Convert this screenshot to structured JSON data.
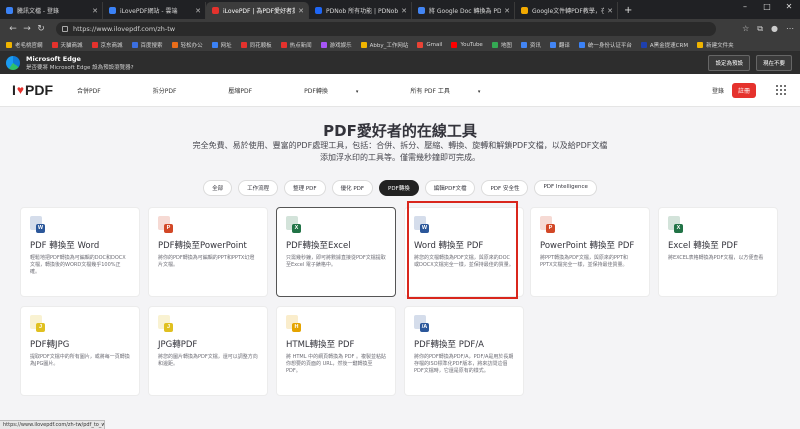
{
  "tabs": [
    {
      "title": "騰訊文檔 - 登錄",
      "color": "#3b82f6"
    },
    {
      "title": "iLovePDF網站 - 雲端",
      "color": "#3b82f6"
    },
    {
      "title": "iLovePDF | 為PDF愛好者提供的PDF",
      "color": "#e5322d",
      "active": true
    },
    {
      "title": "PDNob 所有功能 | PDNob PDF 編",
      "color": "#1e66f5"
    },
    {
      "title": "將 Google Doc 轉換為 PDF 的三個",
      "color": "#4285f4"
    },
    {
      "title": "Google文件轉PDF教學，在iOS/An",
      "color": "#f2a900"
    }
  ],
  "address": "https://www.ilovepdf.com/zh-tw",
  "bookmarks": [
    {
      "label": "老毛桃官網",
      "color": "#f0b400"
    },
    {
      "label": "天貓商城",
      "color": "#e5322d"
    },
    {
      "label": "京东商城",
      "color": "#e5322d"
    },
    {
      "label": "百度搜索",
      "color": "#3b6fe0"
    },
    {
      "label": "轻松办公",
      "color": "#e96d1a"
    },
    {
      "label": "网址",
      "color": "#3b82f6"
    },
    {
      "label": "同花顺板",
      "color": "#e5322d"
    },
    {
      "label": "热点新闻",
      "color": "#e5322d"
    },
    {
      "label": "游戏娱乐",
      "color": "#a855f7"
    },
    {
      "label": "Abby_工作网站",
      "color": "#f0b400"
    },
    {
      "label": "Gmail",
      "color": "#ea4335"
    },
    {
      "label": "YouTube",
      "color": "#ff0000"
    },
    {
      "label": "地图",
      "color": "#34a853"
    },
    {
      "label": "资讯",
      "color": "#4285f4"
    },
    {
      "label": "翻译",
      "color": "#4285f4"
    },
    {
      "label": "统一身份认证平台",
      "color": "#3b82f6"
    },
    {
      "label": "A黑金提速CRM",
      "color": "#1e40af"
    },
    {
      "label": "新建文件夹",
      "color": "#f0b400"
    }
  ],
  "edge": {
    "title": "Microsoft Edge",
    "subtitle": "是否要將 Microsoft Edge 設為預設瀏覽器?",
    "btn_default": "設定為預設",
    "btn_later": "現在不要"
  },
  "site": {
    "brand_left": "I",
    "brand_right": "PDF",
    "nav": [
      "合併PDF",
      "拆分PDF",
      "壓縮PDF",
      "PDF轉換",
      "所有 PDF 工具"
    ],
    "login": "登錄",
    "signup": "註冊",
    "hero_title": "PDF愛好者的在線工具",
    "hero_sub": "完全免費、易於使用、豐富的PDF處理工具，包括：合併、拆分、壓縮、轉換、旋轉和解鎖PDF文檔，以及給PDF文檔添加浮水印的工具等。僅需幾秒鐘即可完成。",
    "filters": [
      "全部",
      "工作流程",
      "整理 PDF",
      "優化 PDF",
      "PDF轉換",
      "編輯PDF文檔",
      "PDF 安全性",
      "PDF Intelligence"
    ],
    "active_filter": 4
  },
  "cards": [
    {
      "title": "PDF 轉換至 Word",
      "desc": "輕鬆地把PDF轉換為可編輯的DOC和DOCX文檔，轉換後的WORD文檔幾乎100%正確。",
      "icon_color": "#2b579a",
      "badge": "W"
    },
    {
      "title": "PDF轉換至PowerPoint",
      "desc": "將你的PDF轉換為可編輯的PPT和PPTX幻燈片文檔。",
      "icon_color": "#d24726",
      "badge": "P"
    },
    {
      "title": "PDF轉換至Excel",
      "desc": "只需幾秒鐘，即可將數據直接從PDF文檔提取至Excel 電子錶格中。",
      "icon_color": "#217346",
      "badge": "X"
    },
    {
      "title": "Word 轉換至 PDF",
      "desc": "將您的文檔轉換為PDF文檔，與原來的DOC或DOCX文檔完全一樣，並保持最佳的質量。",
      "icon_color": "#2b579a",
      "badge": "W"
    },
    {
      "title": "PowerPoint 轉換至 PDF",
      "desc": "將PPT轉換為PDF文檔，與原來的PPT和PPTX文檔完全一樣，並保持最佳質量。",
      "icon_color": "#d24726",
      "badge": "P"
    },
    {
      "title": "Excel 轉換至 PDF",
      "desc": "將EXCEL表格轉換為PDF文檔，以方便查看",
      "icon_color": "#217346",
      "badge": "X"
    },
    {
      "title": "PDF轉JPG",
      "desc": "提取PDF文檔中的所有圖片，或將每一頁轉換為JPG圖片。",
      "icon_color": "#e0c020",
      "badge": "J"
    },
    {
      "title": "JPG轉PDF",
      "desc": "將您的圖片轉換為PDF文檔，還可以調整方向和邊距。",
      "icon_color": "#e0c020",
      "badge": "J"
    },
    {
      "title": "HTML轉換至 PDF",
      "desc": "將 HTML 中的網頁轉換為 PDF 。複製並粘貼你想要的頁面的 URL，然後一鍵轉換至 PDF。",
      "icon_color": "#e5a400",
      "badge": "H"
    },
    {
      "title": "PDF轉換至 PDF/A",
      "desc": "將你的PDF轉換為PDF/A，PDF/A是用於長期存檔的ISO標準化PDF版本，將來訪問這個PDF文檔時，它還是原有的樣式。",
      "icon_color": "#2b579a",
      "badge": "/A"
    }
  ],
  "status_url": "https://www.ilovepdf.com/zh-tw/pdf_to_word"
}
